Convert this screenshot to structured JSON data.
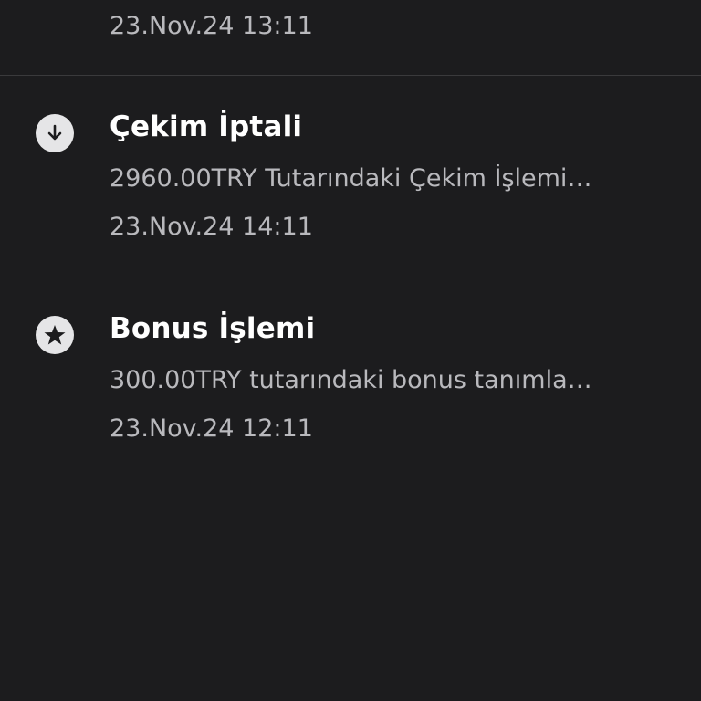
{
  "notifications": [
    {
      "icon": "",
      "title": "",
      "description": "",
      "date": "23.Nov.24 13:11"
    },
    {
      "icon": "arrow-down-circle-icon",
      "title": "Çekim İptali",
      "description": "2960.00TRY Tutarındaki Çekim İşlemi…",
      "date": "23.Nov.24 14:11"
    },
    {
      "icon": "star-circle-icon",
      "title": "Bonus İşlemi",
      "description": "300.00TRY tutarındaki bonus tanımla…",
      "date": "23.Nov.24 12:11"
    }
  ],
  "colors": {
    "background": "#1c1c1e",
    "divider": "#3a3a3c",
    "title": "#ffffff",
    "secondary_text": "#b9b9bd",
    "icon_bg": "#e5e5e7",
    "icon_fg": "#1c1c1e"
  }
}
